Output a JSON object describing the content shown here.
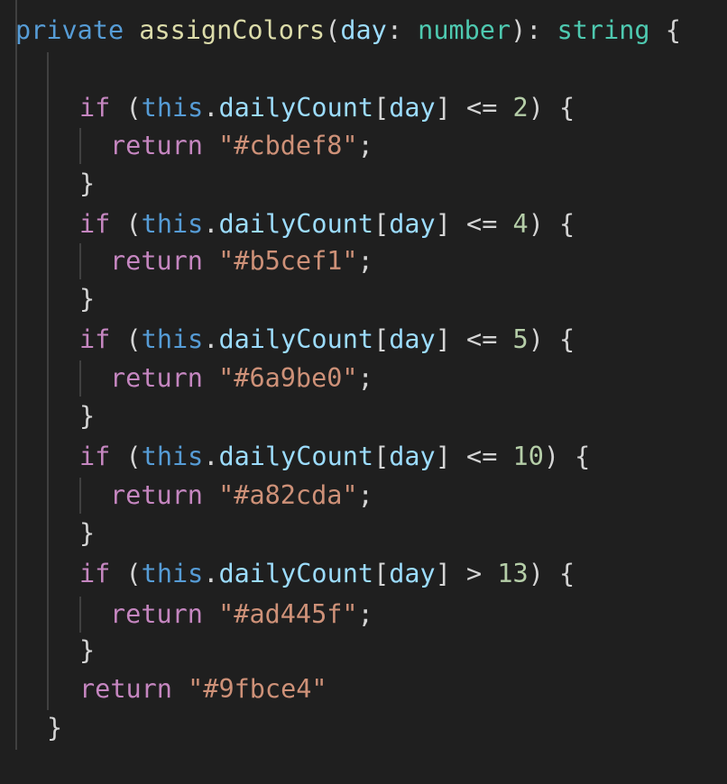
{
  "code": {
    "signature": {
      "modifier": "private",
      "name": "assignColors",
      "open_paren": "(",
      "param": "day",
      "colon": ": ",
      "param_type": "number",
      "close": "): ",
      "return_type": "string",
      "brace": " {"
    },
    "conditions": [
      {
        "keyword": "if",
        "open": " (",
        "this": "this",
        "dot": ".",
        "prop": "dailyCount",
        "lb": "[",
        "index": "day",
        "rb": "]",
        "op": " <= ",
        "value": "2",
        "close": ") {",
        "ret": "return",
        "space": " ",
        "color": "\"#cbdef8\"",
        "semi": ";",
        "end": "}"
      },
      {
        "keyword": "if",
        "open": " (",
        "this": "this",
        "dot": ".",
        "prop": "dailyCount",
        "lb": "[",
        "index": "day",
        "rb": "]",
        "op": " <= ",
        "value": "4",
        "close": ") {",
        "ret": "return",
        "space": " ",
        "color": "\"#b5cef1\"",
        "semi": ";",
        "end": "}"
      },
      {
        "keyword": "if",
        "open": " (",
        "this": "this",
        "dot": ".",
        "prop": "dailyCount",
        "lb": "[",
        "index": "day",
        "rb": "]",
        "op": " <= ",
        "value": "5",
        "close": ") {",
        "ret": "return",
        "space": " ",
        "color": "\"#6a9be0\"",
        "semi": ";",
        "end": "}"
      },
      {
        "keyword": "if",
        "open": " (",
        "this": "this",
        "dot": ".",
        "prop": "dailyCount",
        "lb": "[",
        "index": "day",
        "rb": "]",
        "op": " <= ",
        "value": "10",
        "close": ") {",
        "ret": "return",
        "space": " ",
        "color": "\"#a82cda\"",
        "semi": ";",
        "end": "}"
      },
      {
        "keyword": "if",
        "open": " (",
        "this": "this",
        "dot": ".",
        "prop": "dailyCount",
        "lb": "[",
        "index": "day",
        "rb": "]",
        "op": " > ",
        "value": "13",
        "close": ") {",
        "ret": "return",
        "space": " ",
        "color": "\"#ad445f\"",
        "semi": ";",
        "end": "}"
      }
    ],
    "fallback": {
      "ret": "return",
      "space": " ",
      "color": "\"#9fbce4\""
    },
    "closing_brace": "}"
  },
  "theme": {
    "background": "#1f1f1f",
    "keyword": "#569cd6",
    "function": "#dcdcaa",
    "variable": "#9cdcfe",
    "type": "#4ec9b0",
    "control": "#c586c0",
    "number": "#b5cea8",
    "string": "#ce9178",
    "punctuation": "#d4d4d4"
  }
}
